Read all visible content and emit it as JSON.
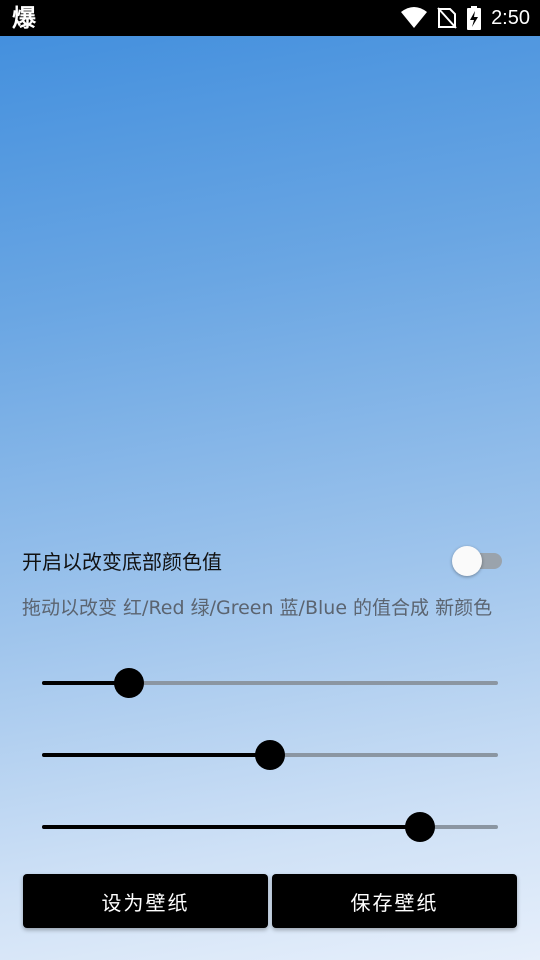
{
  "status_bar": {
    "app_icon": "爆",
    "time": "2:50",
    "icons": [
      "wifi-icon",
      "no-sim-icon",
      "battery-charging-icon"
    ]
  },
  "toggle": {
    "label": "开启以改变底部颜色值",
    "state": false
  },
  "hint": "拖动以改变 红/Red 绿/Green 蓝/Blue 的值合成 新颜色",
  "sliders": [
    {
      "name": "red",
      "value": 0.19
    },
    {
      "name": "green",
      "value": 0.5
    },
    {
      "name": "blue",
      "value": 0.83
    }
  ],
  "buttons": {
    "set_wallpaper": "设为壁纸",
    "save_wallpaper": "保存壁纸"
  },
  "colors": {
    "gradient_top": "#3f8ddd",
    "gradient_bottom": "#e6effb",
    "accent": "#000000",
    "track": "#8b96a2"
  }
}
